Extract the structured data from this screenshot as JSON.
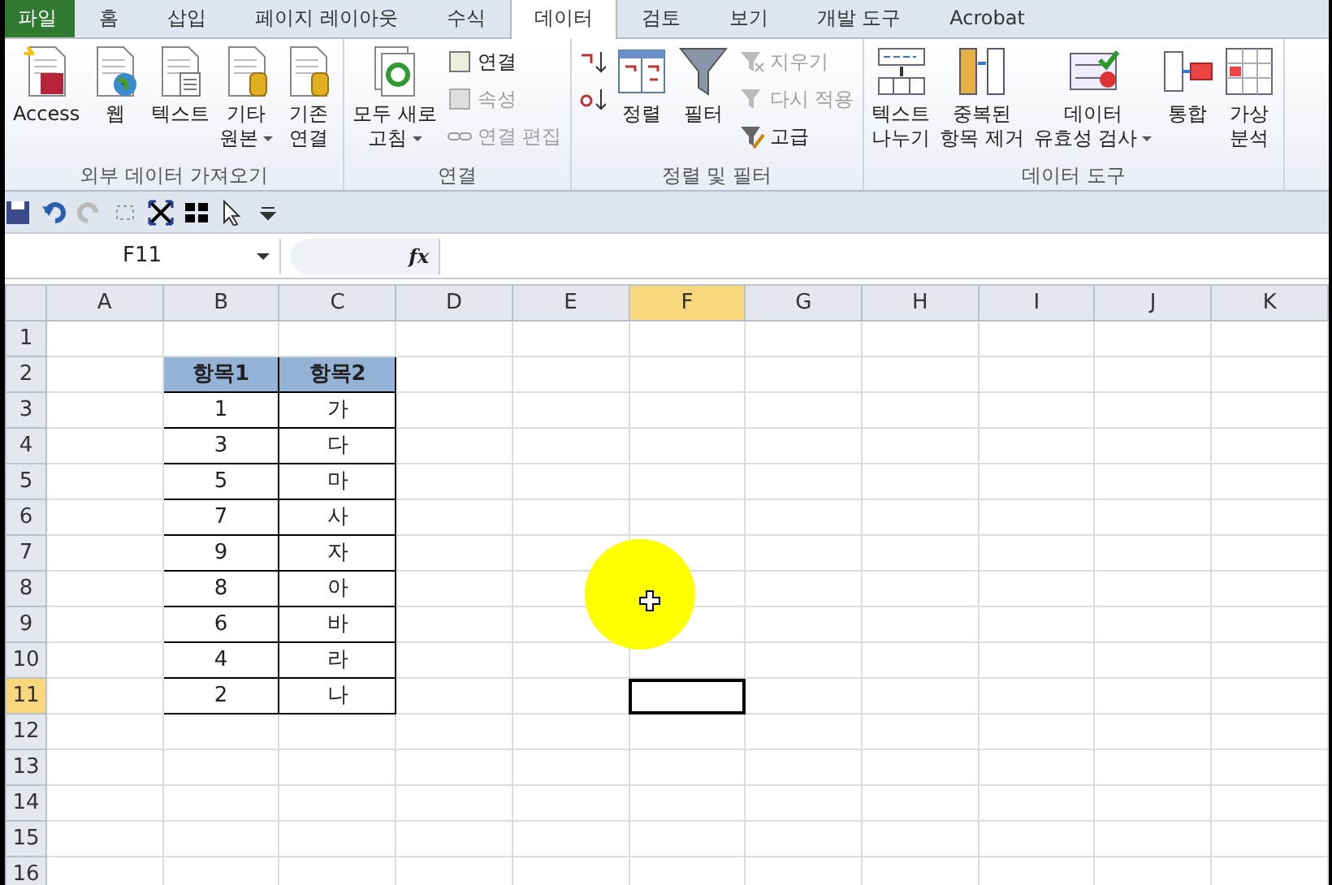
{
  "tabs": [
    {
      "label": "파일",
      "kind": "file",
      "selected": false
    },
    {
      "label": "홈",
      "kind": "tab",
      "selected": false
    },
    {
      "label": "삽입",
      "kind": "tab",
      "selected": false
    },
    {
      "label": "페이지 레이아웃",
      "kind": "tab",
      "selected": false
    },
    {
      "label": "수식",
      "kind": "tab",
      "selected": false
    },
    {
      "label": "데이터",
      "kind": "tab",
      "selected": true
    },
    {
      "label": "검토",
      "kind": "tab",
      "selected": false
    },
    {
      "label": "보기",
      "kind": "tab",
      "selected": false
    },
    {
      "label": "개발 도구",
      "kind": "tab",
      "selected": false
    },
    {
      "label": "Acrobat",
      "kind": "tab",
      "selected": false
    }
  ],
  "ribbon_groups": [
    {
      "label": "외부 데이터 가져오기",
      "items": [
        {
          "kind": "large",
          "lines": [
            "Access"
          ],
          "dropdown": false
        },
        {
          "kind": "large",
          "lines": [
            "웹"
          ],
          "dropdown": false
        },
        {
          "kind": "large",
          "lines": [
            "텍스트"
          ],
          "dropdown": false
        },
        {
          "kind": "large",
          "lines": [
            "기타",
            "원본"
          ],
          "dropdown": true
        },
        {
          "kind": "large",
          "lines": [
            "기존",
            "연결"
          ],
          "dropdown": false
        }
      ]
    },
    {
      "label": "연결",
      "items": [
        {
          "kind": "large",
          "lines": [
            "모두 새로",
            "고침"
          ],
          "dropdown": true
        },
        {
          "kind": "stack",
          "items": [
            {
              "label": "연결",
              "disabled": false
            },
            {
              "label": "속성",
              "disabled": true
            },
            {
              "label": "연결 편집",
              "disabled": true
            }
          ]
        }
      ]
    },
    {
      "label": "정렬 및 필터",
      "items": [
        {
          "kind": "stack",
          "items": [
            {
              "disabled": false
            },
            {
              "disabled": false
            }
          ]
        },
        {
          "kind": "large",
          "lines": [
            "정렬"
          ],
          "dropdown": false
        },
        {
          "kind": "large",
          "lines": [
            "필터"
          ],
          "dropdown": false
        },
        {
          "kind": "stack",
          "items": [
            {
              "label": "지우기",
              "disabled": true
            },
            {
              "label": "다시 적용",
              "disabled": true
            },
            {
              "label": "고급",
              "disabled": false
            }
          ]
        }
      ]
    },
    {
      "label": "데이터 도구",
      "items": [
        {
          "kind": "large",
          "lines": [
            "텍스트",
            "나누기"
          ],
          "dropdown": false
        },
        {
          "kind": "large",
          "lines": [
            "중복된",
            "항목 제거"
          ],
          "dropdown": false
        },
        {
          "kind": "large",
          "lines": [
            "데이터",
            "유효성 검사"
          ],
          "dropdown": true
        },
        {
          "kind": "large",
          "lines": [
            "통합"
          ],
          "dropdown": false
        },
        {
          "kind": "large",
          "lines": [
            "가상",
            "분석"
          ],
          "dropdown": false
        }
      ]
    }
  ],
  "formula_bar": {
    "name_box": "F11",
    "fx": "fx"
  },
  "columns": [
    {
      "label": "A",
      "selected": false
    },
    {
      "label": "B",
      "selected": false
    },
    {
      "label": "C",
      "selected": false
    },
    {
      "label": "D",
      "selected": false
    },
    {
      "label": "E",
      "selected": false
    },
    {
      "label": "F",
      "selected": true
    },
    {
      "label": "G",
      "selected": false
    },
    {
      "label": "H",
      "selected": false
    },
    {
      "label": "I",
      "selected": false
    },
    {
      "label": "J",
      "selected": false
    },
    {
      "label": "K",
      "selected": false
    }
  ],
  "rows": [
    {
      "label": "1",
      "selected": false
    },
    {
      "label": "2",
      "selected": false
    },
    {
      "label": "3",
      "selected": false
    },
    {
      "label": "4",
      "selected": false
    },
    {
      "label": "5",
      "selected": false
    },
    {
      "label": "6",
      "selected": false
    },
    {
      "label": "7",
      "selected": false
    },
    {
      "label": "8",
      "selected": false
    },
    {
      "label": "9",
      "selected": false
    },
    {
      "label": "10",
      "selected": false
    },
    {
      "label": "11",
      "selected": true
    },
    {
      "label": "12",
      "selected": false
    },
    {
      "label": "13",
      "selected": false
    },
    {
      "label": "14",
      "selected": false
    },
    {
      "label": "15",
      "selected": false
    },
    {
      "label": "16",
      "selected": false
    }
  ],
  "data_table": {
    "headers": [
      "항목1",
      "항목2"
    ],
    "rows": [
      [
        "1",
        "가"
      ],
      [
        "3",
        "다"
      ],
      [
        "5",
        "마"
      ],
      [
        "7",
        "사"
      ],
      [
        "9",
        "자"
      ],
      [
        "8",
        "아"
      ],
      [
        "6",
        "바"
      ],
      [
        "4",
        "라"
      ],
      [
        "2",
        "나"
      ]
    ]
  }
}
